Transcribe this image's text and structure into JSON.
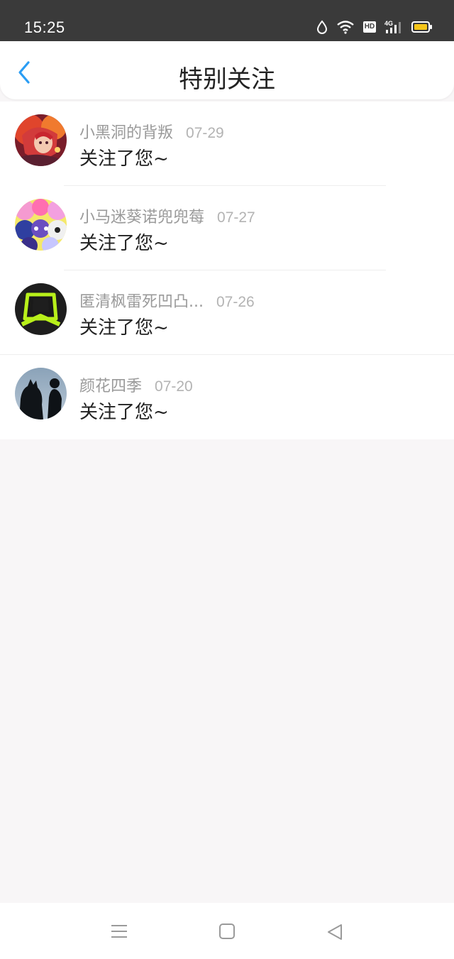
{
  "status_bar": {
    "time": "15:25",
    "network_label": "4G",
    "hd_label": "HD",
    "icons": [
      "data-saver-icon",
      "wifi-icon",
      "hd-icon",
      "signal-4g-icon",
      "battery-icon"
    ],
    "battery_color": "#f5c518"
  },
  "header": {
    "title": "特别关注",
    "back_icon": "chevron-left-icon",
    "accent_color": "#2a9df4"
  },
  "notifications": [
    {
      "user_name": "小黑洞的背叛",
      "date": "07-29",
      "message": "关注了您~",
      "avatar": "anime-avatar-red-hair"
    },
    {
      "user_name": "小马迷葵诺兜兜莓",
      "date": "07-27",
      "message": "关注了您~",
      "avatar": "pony-avatar-collage"
    },
    {
      "user_name": "匿清枫雷死凹凸...",
      "date": "07-26",
      "message": "关注了您~",
      "avatar": "green-logo-avatar"
    },
    {
      "user_name": "颜花四季",
      "date": "07-20",
      "message": "关注了您~",
      "avatar": "silhouette-avatar"
    }
  ],
  "nav_bar": {
    "icons": [
      "menu-icon",
      "home-icon",
      "back-icon"
    ]
  }
}
